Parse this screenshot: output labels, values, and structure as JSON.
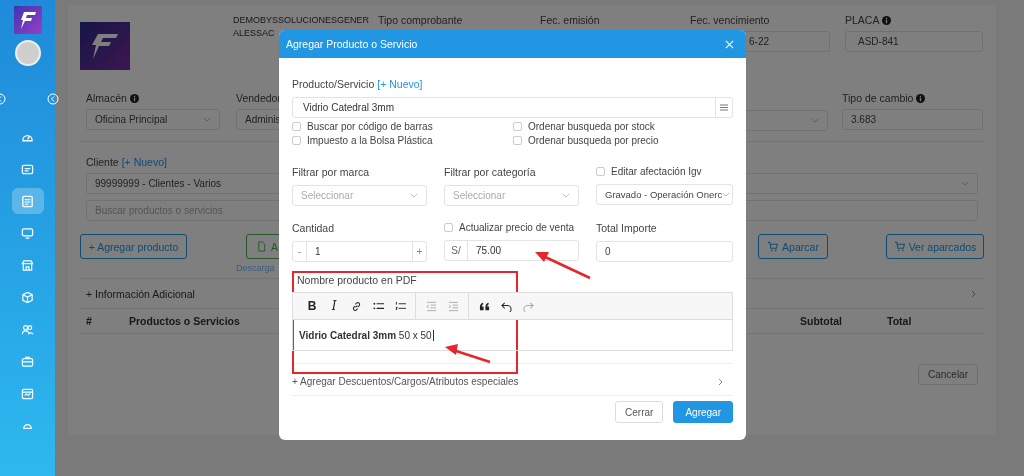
{
  "sidebar": {
    "items": [
      {
        "selected": false
      },
      {
        "selected": false
      },
      {
        "selected": true
      },
      {
        "selected": false
      },
      {
        "selected": false
      },
      {
        "selected": false
      },
      {
        "selected": false
      },
      {
        "selected": false
      },
      {
        "selected": false
      },
      {
        "selected": false
      }
    ]
  },
  "page": {
    "company": [
      "DEMOBYSSOLUCIONESGENER",
      "ALESSAC"
    ],
    "header_labels": [
      {
        "text": "Tipo comprobante",
        "info": false
      },
      {
        "text": "Fec. emisión",
        "info": false
      },
      {
        "text": "Fec. vencimiento",
        "info": false
      },
      {
        "text": "PLACA",
        "info": true
      }
    ],
    "due_date_value": "6-22",
    "placa_value": "ASD-841",
    "almacen": {
      "label": "Almacén",
      "info": true,
      "value": "Oficina Principal"
    },
    "vendedor": {
      "label": "Vendedor",
      "value": "Adminis"
    },
    "tipo_cambio": {
      "label": "Tipo de cambio",
      "info": true,
      "value": "3.683"
    },
    "cliente": {
      "label": "Cliente",
      "link": "[+ Nuevo]",
      "value": "99999999 - Clientes - Varios"
    },
    "product_search": {
      "placeholder": "Buscar productos o servicios"
    },
    "buttons": {
      "add_product": "+ Agregar producto",
      "document": "A",
      "download_link": "Descarga",
      "park": "Aparcar",
      "view_parked": "Ver aparcados"
    },
    "additional_info": "+ Información Adicional",
    "table": {
      "columns": [
        "#",
        "Productos o Servicios",
        "Subtotal",
        "Total"
      ]
    },
    "cancel": "Cancelar"
  },
  "modal": {
    "title": "Agregar Producto o Servicio",
    "product": {
      "label": "Producto/Servicio",
      "link": "[+ Nuevo]",
      "value": "Vidrio Catedral 3mm"
    },
    "options": [
      {
        "label": "Buscar por código de barras",
        "checked": false
      },
      {
        "label": "Ordenar busqueda por stock",
        "checked": false
      },
      {
        "label": "Impuesto a la Bolsa Plástica",
        "checked": false
      },
      {
        "label": "Ordenar busqueda por precio",
        "checked": false
      }
    ],
    "filters": [
      {
        "kind": "select",
        "label": "Filtrar por marca",
        "placeholder": "Seleccionar"
      },
      {
        "kind": "select",
        "label": "Filtrar por categoría",
        "placeholder": "Seleccionar"
      },
      {
        "kind": "check-select",
        "label": "Editar afectación Igv",
        "checked": false,
        "value": "Gravado - Operación Onerc"
      }
    ],
    "quantity": {
      "label": "Cantidad",
      "minus": "-",
      "value": "1",
      "plus": "+"
    },
    "price": {
      "label": "Actualizar precio de venta",
      "checked": false,
      "currency": "S/",
      "value": "75.00"
    },
    "total": {
      "label": "Total Importe",
      "value": "0"
    },
    "pdf_name": {
      "label": "Nombre producto en PDF",
      "bold": "B",
      "italic": "I",
      "content": "**Vidrio Catedral 3mm** 50 x 50"
    },
    "extras": "+ Agregar Descuentos/Cargos/Atributos especiales",
    "buttons": [
      {
        "label": "Cerrar",
        "primary": false
      },
      {
        "label": "Agregar",
        "primary": true
      }
    ]
  }
}
